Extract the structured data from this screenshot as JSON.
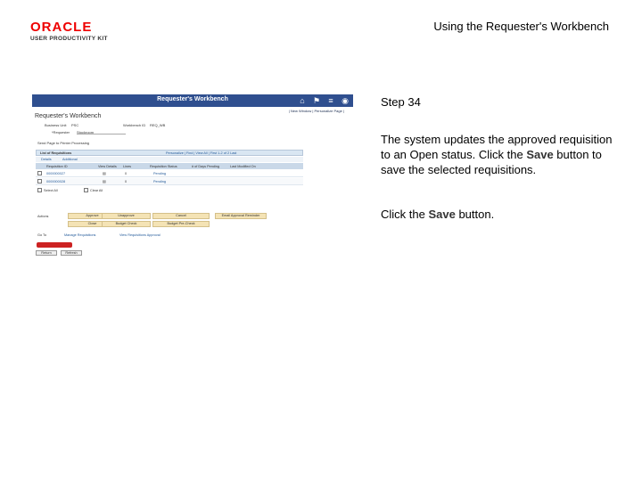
{
  "header": {
    "logo_text": "ORACLE",
    "logo_sub": "USER PRODUCTIVITY KIT",
    "title": "Using the Requester's Workbench"
  },
  "shot": {
    "bar_title": "Requester's Workbench",
    "sublinks": "| New Window | Personalize Page |",
    "page_title": "Requester's Workbench",
    "bu_label": "Business Unit",
    "bu_value": "PSC",
    "workbench_label": "Workbench ID",
    "workbench_value": "REQ_WB",
    "requester_label": "*Requester",
    "requester_value": "Stockroom",
    "send_label": "Send Page to Printer Processing",
    "grid_title": "List of Requisitions",
    "grid_nav": "Personalize | Find | View All | First 1-2 of 2 Last",
    "tabs": [
      "Details",
      "Additional"
    ],
    "columns": [
      "Requisition ID",
      "View Details",
      "Lines",
      "Requisition Status",
      "# of Days Pending",
      "Last Modified On"
    ],
    "rows": [
      {
        "id": "0000000027",
        "lines": "0",
        "status": "Pending"
      },
      {
        "id": "0000000028",
        "lines": "0",
        "status": "Pending"
      }
    ],
    "select_all": "Select All",
    "clear_all": "Clear All",
    "actions_label": "Actions",
    "action_buttons": [
      "Approve",
      "Unapprove",
      "Cancel",
      "Email Approval Reminder",
      "Close",
      "Budget Check",
      "Budget Pre-Check"
    ],
    "go_to": "Go To",
    "go_links": [
      "Manage Requisitions",
      "View Requisitions Approval"
    ],
    "bottom_buttons": [
      "Return",
      "Refresh"
    ]
  },
  "content": {
    "step": "Step 34",
    "desc_a": "The system updates the approved requisition to an Open status.  Click the ",
    "desc_b": "Save",
    "desc_c": " button to save the selected requisitions.",
    "instr_a": "Click the ",
    "instr_b": "Save",
    "instr_c": " button."
  },
  "colors": {
    "brand_red": "#e00000",
    "bar": "#2f4f8f",
    "button": "#f4e3b5",
    "save_button": "#cc2222"
  }
}
